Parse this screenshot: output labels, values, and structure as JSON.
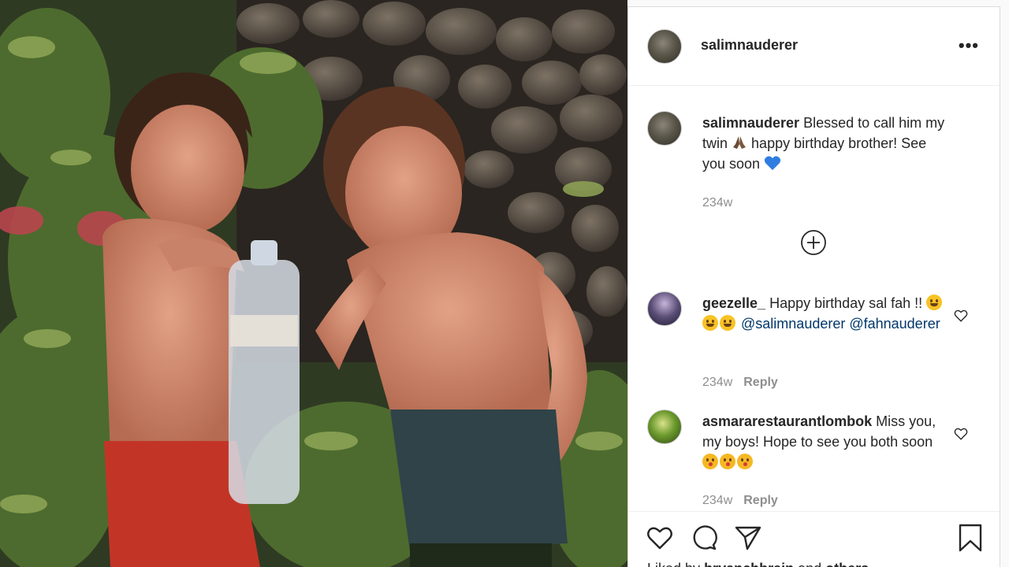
{
  "post": {
    "username": "salimnauderer",
    "more_label": "•••"
  },
  "caption": {
    "username": "salimnauderer",
    "text_part1": "Blessed to call him my twin",
    "text_part2": "happy birthday brother! See you soon",
    "emoji_1": "folded-hands",
    "emoji_2": "blue-heart",
    "age": "234w"
  },
  "comments": [
    {
      "username": "geezelle_",
      "text": "Happy birthday sal fah !!",
      "emojis": [
        "grinning-squinting-face",
        "grinning-face",
        "grinning-face"
      ],
      "mentions": "@salimnauderer @fahnauderer",
      "age": "234w",
      "reply_label": "Reply"
    },
    {
      "username": "asmararestaurantlombok",
      "text": "Miss you, my boys! Hope to see you both soon",
      "emojis": [
        "face-blowing-kiss",
        "face-blowing-kiss",
        "face-blowing-kiss"
      ],
      "age": "234w",
      "reply_label": "Reply"
    }
  ],
  "actions": {
    "icons": [
      "heart-icon",
      "comment-icon",
      "share-icon",
      "bookmark-icon"
    ]
  },
  "likes": {
    "prefix": "Liked by",
    "user": "bryanchbrain",
    "suffix": "and",
    "others": "others"
  },
  "colors": {
    "text": "#262626",
    "muted": "#8e8e8e",
    "border": "#dbdbdb",
    "heart_blue": "#2f7de1"
  }
}
